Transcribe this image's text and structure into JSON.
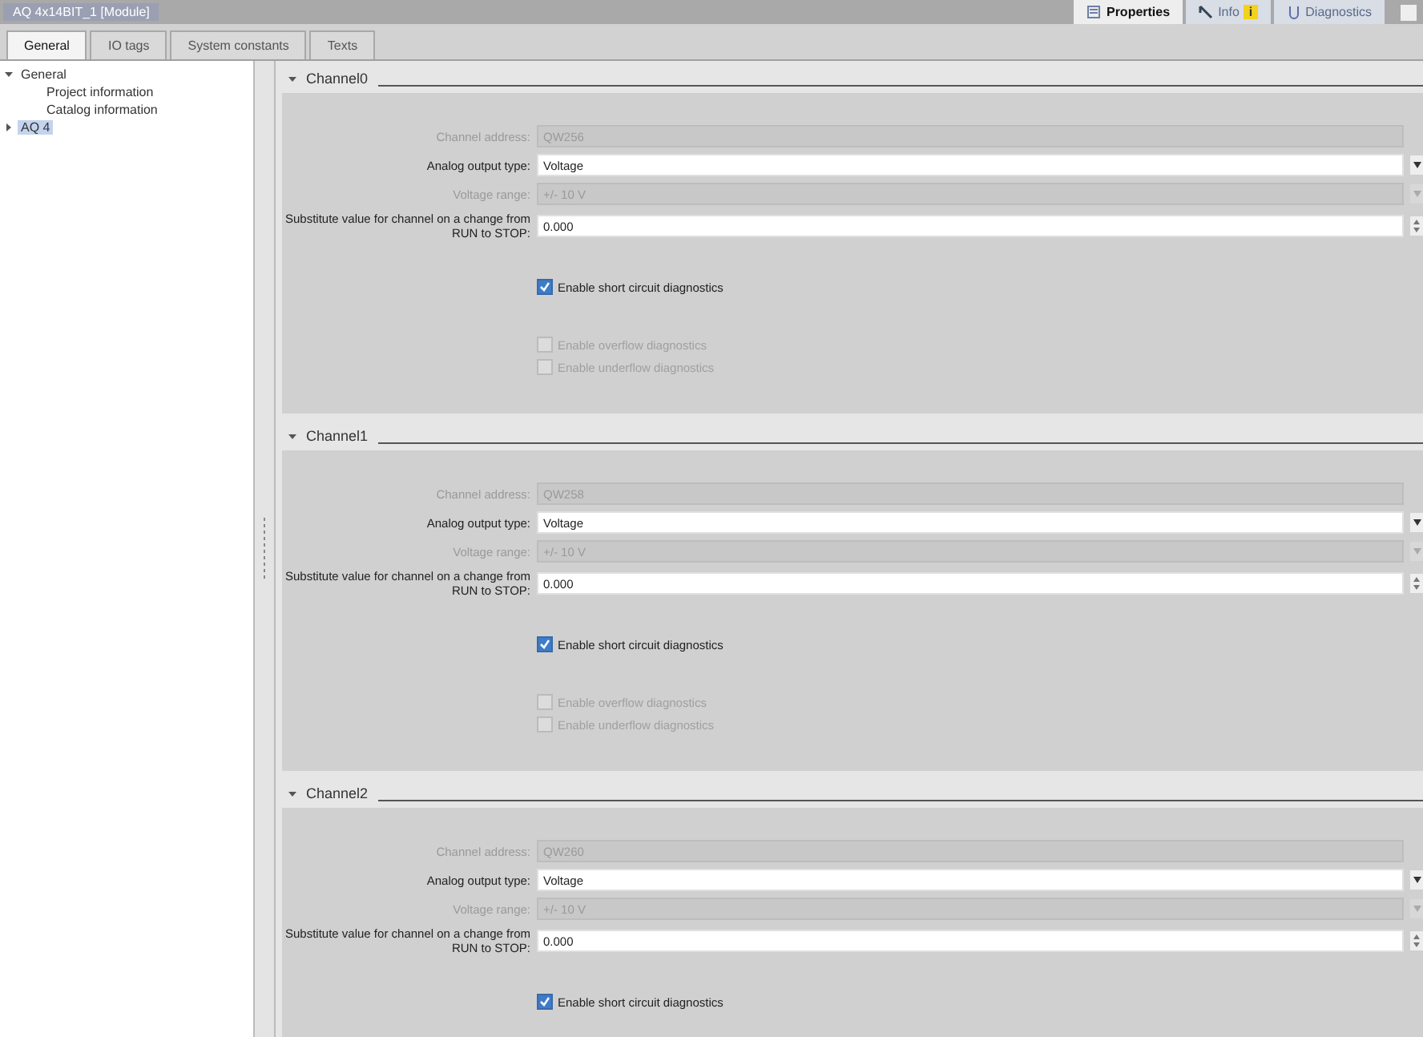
{
  "window": {
    "title": "AQ 4x14BIT_1 [Module]"
  },
  "inspector_tabs": [
    {
      "label": "Properties",
      "selected": true
    },
    {
      "label": "Info",
      "selected": false,
      "badge": "i"
    },
    {
      "label": "Diagnostics",
      "selected": false
    }
  ],
  "tabs": [
    {
      "label": "General",
      "selected": true
    },
    {
      "label": "IO tags",
      "selected": false
    },
    {
      "label": "System constants",
      "selected": false
    },
    {
      "label": "Texts",
      "selected": false
    }
  ],
  "tree": [
    {
      "label": "General",
      "expanded": true,
      "selected": false,
      "children": [
        {
          "label": "Project information",
          "selected": false
        },
        {
          "label": "Catalog information",
          "selected": false
        }
      ]
    },
    {
      "label": "AQ 4",
      "expanded": false,
      "selected": true
    }
  ],
  "channels": [
    {
      "title": "Channel0",
      "fields": [
        {
          "label": "Channel address:",
          "value": "QW256",
          "kind": "text",
          "disabled": true
        },
        {
          "label": "Analog output type:",
          "value": "Voltage",
          "kind": "dropdown",
          "disabled": false
        },
        {
          "label": "Voltage range:",
          "value": "+/- 10 V",
          "kind": "dropdown",
          "disabled": true
        },
        {
          "label": "Substitute value for channel on a change from RUN to STOP:",
          "value": "0.000",
          "kind": "spin",
          "disabled": false
        }
      ],
      "checkboxes": [
        {
          "label": "Enable short circuit diagnostics",
          "checked": true,
          "disabled": false
        },
        {
          "label": "Enable overflow diagnostics",
          "checked": false,
          "disabled": true
        },
        {
          "label": "Enable underflow diagnostics",
          "checked": false,
          "disabled": true
        }
      ]
    },
    {
      "title": "Channel1",
      "fields": [
        {
          "label": "Channel address:",
          "value": "QW258",
          "kind": "text",
          "disabled": true
        },
        {
          "label": "Analog output type:",
          "value": "Voltage",
          "kind": "dropdown",
          "disabled": false
        },
        {
          "label": "Voltage range:",
          "value": "+/- 10 V",
          "kind": "dropdown",
          "disabled": true
        },
        {
          "label": "Substitute value for channel on a change from RUN to STOP:",
          "value": "0.000",
          "kind": "spin",
          "disabled": false
        }
      ],
      "checkboxes": [
        {
          "label": "Enable short circuit diagnostics",
          "checked": true,
          "disabled": false
        },
        {
          "label": "Enable overflow diagnostics",
          "checked": false,
          "disabled": true
        },
        {
          "label": "Enable underflow diagnostics",
          "checked": false,
          "disabled": true
        }
      ]
    },
    {
      "title": "Channel2",
      "fields": [
        {
          "label": "Channel address:",
          "value": "QW260",
          "kind": "text",
          "disabled": true
        },
        {
          "label": "Analog output type:",
          "value": "Voltage",
          "kind": "dropdown",
          "disabled": false
        },
        {
          "label": "Voltage range:",
          "value": "+/- 10 V",
          "kind": "dropdown",
          "disabled": true
        },
        {
          "label": "Substitute value for channel on a change from RUN to STOP:",
          "value": "0.000",
          "kind": "spin",
          "disabled": false
        }
      ],
      "checkboxes": [
        {
          "label": "Enable short circuit diagnostics",
          "checked": true,
          "disabled": false
        }
      ]
    }
  ]
}
